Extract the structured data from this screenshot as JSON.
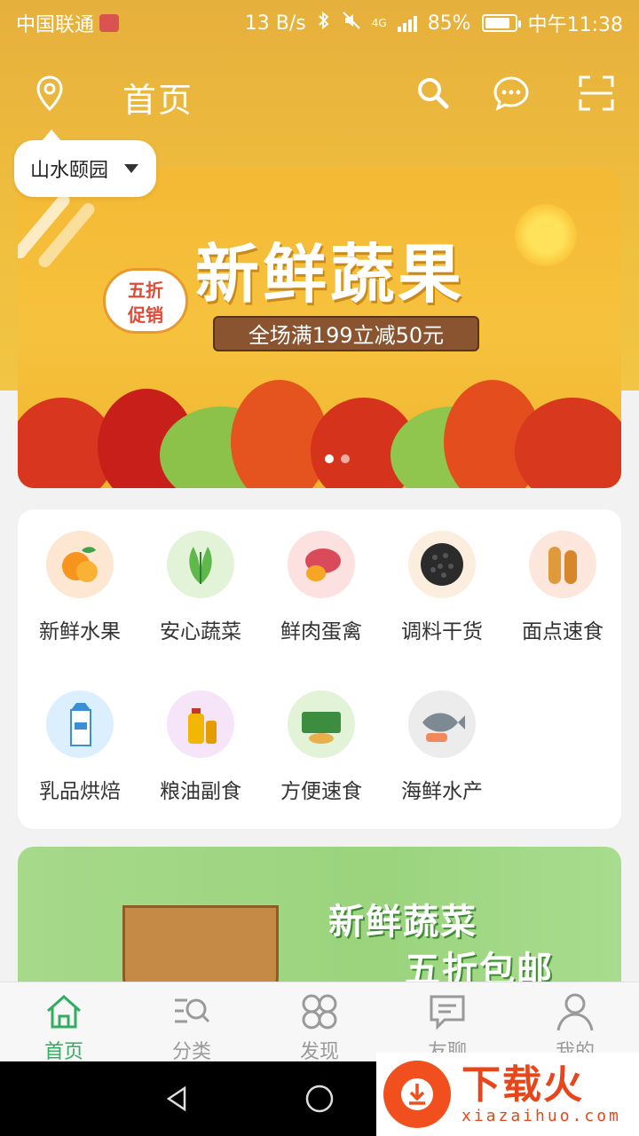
{
  "status_bar": {
    "carrier": "中国联通",
    "net_speed": "13 B/s",
    "network_type": "4G",
    "battery": "85%",
    "battery_level": 0.85,
    "time": "中午11:38"
  },
  "header": {
    "title": "首页",
    "icons": [
      "location-icon",
      "search-icon",
      "message-icon",
      "scan-icon"
    ]
  },
  "location": {
    "name": "山水颐园"
  },
  "banner": {
    "headline": "新鲜蔬果",
    "badge_line1": "五折",
    "badge_line2": "促销",
    "promo": "全场满199立减50元",
    "active_index": 0,
    "count": 2
  },
  "categories": [
    {
      "label": "新鲜水果",
      "icon": "fruit-icon",
      "bg": "#fde7d2"
    },
    {
      "label": "安心蔬菜",
      "icon": "vegetable-icon",
      "bg": "#e2f3d8"
    },
    {
      "label": "鲜肉蛋禽",
      "icon": "meat-egg-icon",
      "bg": "#fde0e0"
    },
    {
      "label": "调料干货",
      "icon": "spice-icon",
      "bg": "#fbeede"
    },
    {
      "label": "面点速食",
      "icon": "bread-icon",
      "bg": "#fde7dc"
    },
    {
      "label": "乳品烘焙",
      "icon": "milk-icon",
      "bg": "#dcefff"
    },
    {
      "label": "粮油副食",
      "icon": "oil-icon",
      "bg": "#f6e4f8"
    },
    {
      "label": "方便速食",
      "icon": "instant-noodle-icon",
      "bg": "#e2f3d8"
    },
    {
      "label": "海鲜水产",
      "icon": "fish-icon",
      "bg": "#ececec"
    }
  ],
  "banner2": {
    "line1": "新鲜蔬菜",
    "line2": "五折包邮"
  },
  "tabs": [
    {
      "label": "首页",
      "icon": "home-icon",
      "active": true
    },
    {
      "label": "分类",
      "icon": "category-icon",
      "active": false
    },
    {
      "label": "发现",
      "icon": "discover-icon",
      "active": false
    },
    {
      "label": "友聊",
      "icon": "chat-icon",
      "active": false
    },
    {
      "label": "我的",
      "icon": "profile-icon",
      "active": false
    }
  ],
  "colors": {
    "header_bg": "#f0bf3e",
    "accent_active": "#2fae5d",
    "tab_inactive": "#9a9a9a"
  },
  "watermark": {
    "cn": "下载火",
    "en": "xiazaihuo.com"
  }
}
